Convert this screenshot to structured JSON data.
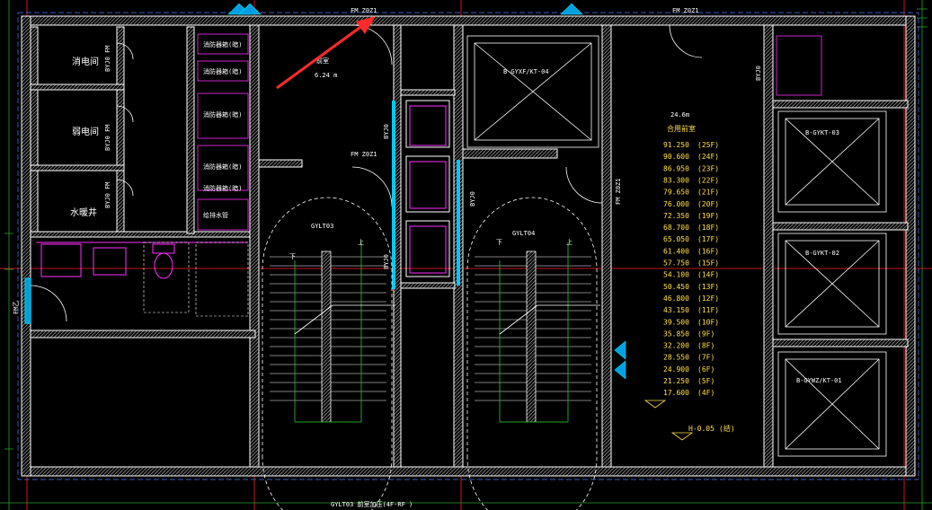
{
  "drawing": {
    "colors": {
      "background": "#000000",
      "wall": "#ffffff",
      "hatch": "#bdbdbd",
      "axis": "#ff2020",
      "dim": "#2aa02a",
      "cyan": "#00c8ff",
      "magenta": "#ff30ff",
      "level": "#ffe04a",
      "arrow": "#ff2a2a"
    },
    "rooms": {
      "xiao_dian": "消电间",
      "ruo_dian": "弱电间",
      "shui_guan": "水暖井"
    },
    "room_tags": [
      "BYJ0 FM",
      "BYJ0 FM",
      "BYJ0 FM"
    ],
    "cabinets": [
      "消防器箱(暗)",
      "消防器箱(暗)",
      "消防器箱(暗)",
      "消防器箱(暗)",
      "消防器箱(暗)",
      "给排水管"
    ],
    "lobby_area": "6.24 m",
    "lobby_label": "前室",
    "door_tags": [
      "FM Z0Z1",
      "FM Z0Z1",
      "FM Z0Z1",
      "FM Z0Z1",
      "FM Z0Z1"
    ],
    "byj_tags": [
      "BYJ0",
      "BYJ0",
      "BYJ0",
      "BYJ0"
    ],
    "stairs": [
      {
        "name": "GYLT03",
        "up": "上",
        "down": "下"
      },
      {
        "name": "GYLT04",
        "up": "上",
        "down": "下"
      }
    ],
    "elevators": [
      "B-GYXF/KT-04",
      "B-GYKT-03",
      "B-GYKT-02",
      "B-GYWZ/KT-01"
    ],
    "hall": {
      "area": "24.6m",
      "label": "合用前室"
    },
    "levels": [
      {
        "e": "91.250",
        "f": "(25F)"
      },
      {
        "e": "90.600",
        "f": "(24F)"
      },
      {
        "e": "86.950",
        "f": "(23F)"
      },
      {
        "e": "83.300",
        "f": "(22F)"
      },
      {
        "e": "79.650",
        "f": "(21F)"
      },
      {
        "e": "76.000",
        "f": "(20F)"
      },
      {
        "e": "72.350",
        "f": "(19F)"
      },
      {
        "e": "68.700",
        "f": "(18F)"
      },
      {
        "e": "65.050",
        "f": "(17F)"
      },
      {
        "e": "61.400",
        "f": "(16F)"
      },
      {
        "e": "57.750",
        "f": "(15F)"
      },
      {
        "e": "54.100",
        "f": "(14F)"
      },
      {
        "e": "50.450",
        "f": "(13F)"
      },
      {
        "e": "46.800",
        "f": "(12F)"
      },
      {
        "e": "43.150",
        "f": "(11F)"
      },
      {
        "e": "39.500",
        "f": "(10F)"
      },
      {
        "e": "35.850",
        "f": "(9F)"
      },
      {
        "e": "32.200",
        "f": "(8F)"
      },
      {
        "e": "28.550",
        "f": "(7F)"
      },
      {
        "e": "24.900",
        "f": "(6F)"
      },
      {
        "e": "21.250",
        "f": "(5F)"
      },
      {
        "e": "17.600",
        "f": "(4F)"
      }
    ],
    "level_base": "H-0.05",
    "level_base_note": "(结)",
    "left_door_tag": "FM乙",
    "bottom_caption": "GYLT03  前室加压(4F-RF )"
  }
}
